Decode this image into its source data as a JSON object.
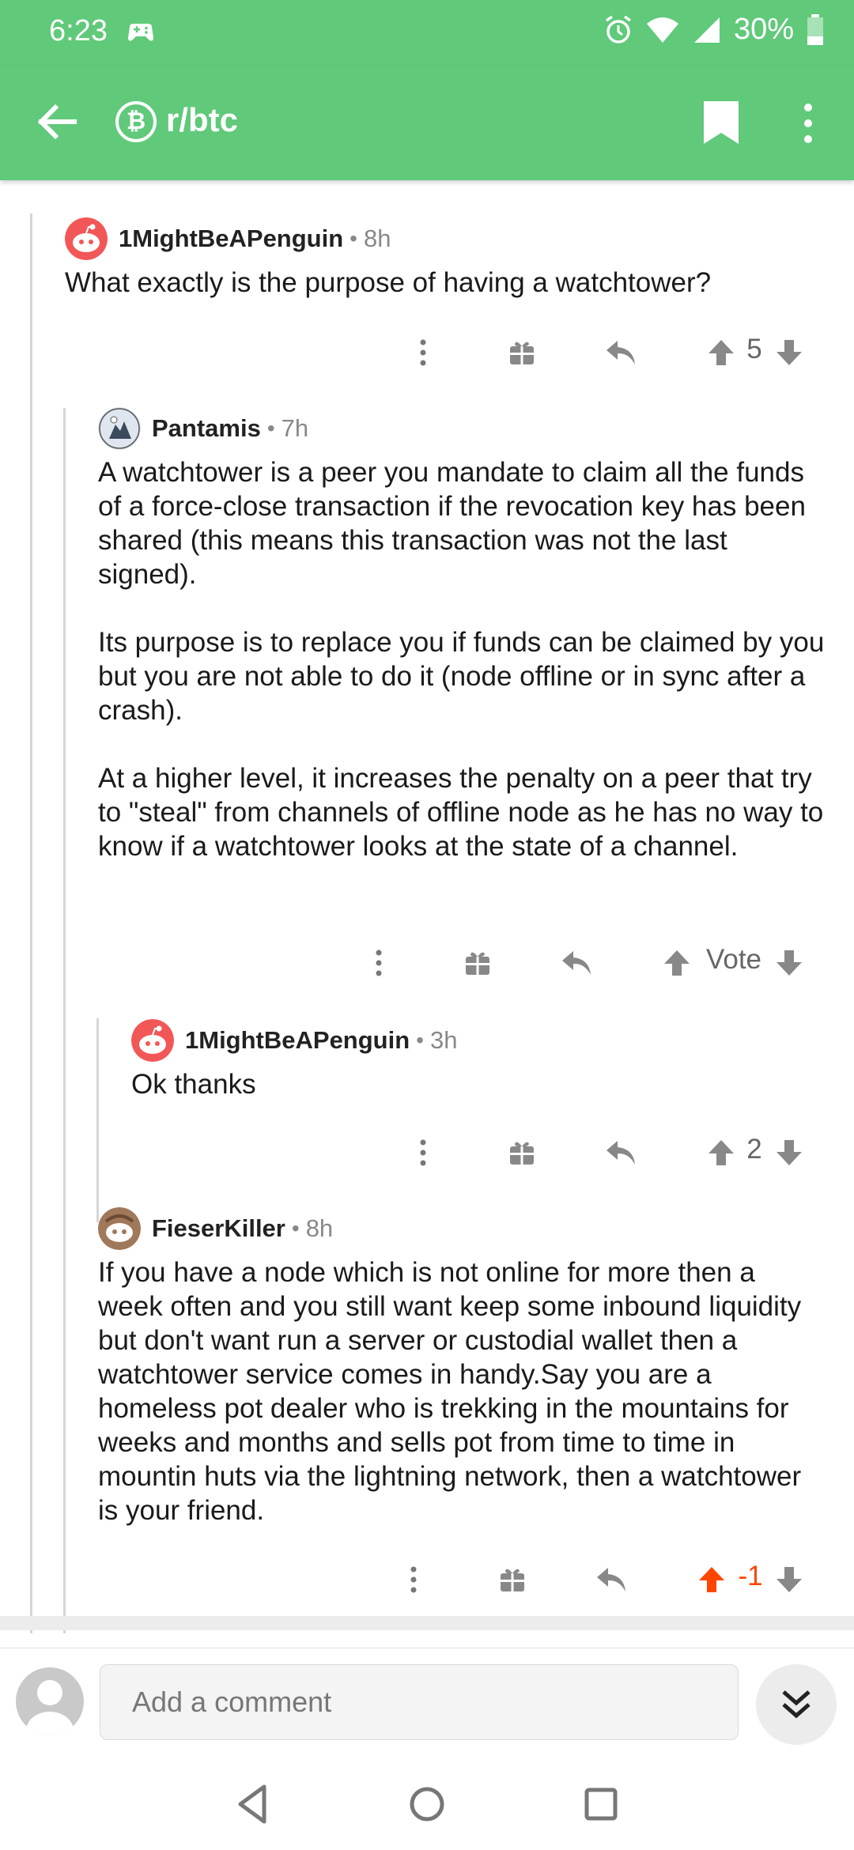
{
  "status_bar": {
    "time": "6:23",
    "battery": "30%"
  },
  "app_bar": {
    "subreddit": "r/btc",
    "sub_icon_glyph": "₿",
    "accent": "#60c97a"
  },
  "comments": [
    {
      "user": "1MightBeAPenguin",
      "age": "8h",
      "paragraphs": [
        "What exactly is the purpose of having a watchtower?"
      ],
      "score": "5"
    },
    {
      "user": "Pantamis",
      "age": "7h",
      "paragraphs": [
        "A watchtower is a peer you mandate to claim all the funds of a force-close transaction if the revocation key has been shared (this means this transaction was not the last signed).",
        "Its purpose is to replace you if funds can be claimed by you but you are not able to do it (node offline or in sync after a crash).",
        "At a higher level, it increases the penalty on a peer that try to \"steal\" from channels of offline node as he has no way to know if a watchtower looks at the state of a channel."
      ],
      "score": "Vote"
    },
    {
      "user": "1MightBeAPenguin",
      "age": "3h",
      "paragraphs": [
        "Ok thanks"
      ],
      "score": "2"
    },
    {
      "user": "FieserKiller",
      "age": "8h",
      "paragraphs": [
        "If you have a node which is not online for more then a week often and you still want keep some inbound liquidity but don't want run a server or custodial wallet then a watchtower service comes in handy.Say you are a homeless pot dealer who is trekking in the mountains for weeks and months and sells pot from time to time in mountin huts via the lightning network, then a watchtower is your friend."
      ],
      "score": "-1",
      "upvoted": true
    }
  ],
  "composer": {
    "placeholder": "Add a comment"
  }
}
